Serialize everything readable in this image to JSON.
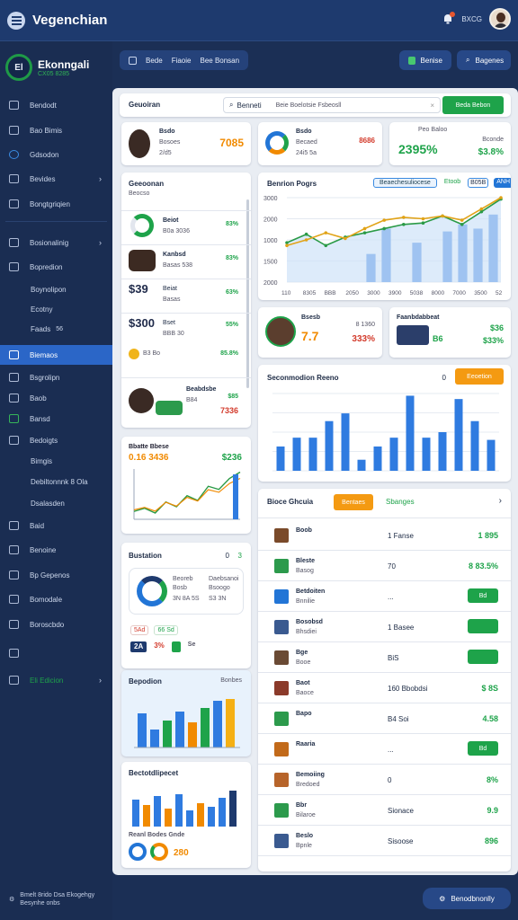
{
  "app": {
    "title": "Vegenchian",
    "code": "BXCG"
  },
  "brand": {
    "name": "Ekonngali",
    "sub": "CX05 8285"
  },
  "sidebar": {
    "items": [
      {
        "label": "Bendodt"
      },
      {
        "label": "Bao Bimis"
      },
      {
        "label": "Gdsodon"
      },
      {
        "label": "Bevides"
      },
      {
        "label": "Bongtgriqien"
      },
      {
        "label": "Bosionalinig"
      },
      {
        "label": "Bopredion"
      },
      {
        "label": "Boynolipon"
      },
      {
        "label": "Ecotny"
      },
      {
        "label": "Faads",
        "badge": "56"
      },
      {
        "label": "Biemaos"
      },
      {
        "label": "Bsgrolipn"
      },
      {
        "label": "Baob"
      },
      {
        "label": "Bansd"
      },
      {
        "label": "Bedoigts"
      },
      {
        "label": "Bimgis"
      },
      {
        "label": "Debiltonnnk 8 Ola"
      },
      {
        "label": "Dsalasden"
      },
      {
        "label": "Baid"
      },
      {
        "label": "Benoine"
      },
      {
        "label": "Bp Gepenos"
      },
      {
        "label": "Bomodale"
      },
      {
        "label": "Boroscbdo"
      },
      {
        "label": "Eli Edicion"
      }
    ],
    "footer": "Bmelt 8rido Dsa Ekogehgy Besynhe onbs"
  },
  "subheader": {
    "crumbs": [
      "Bede",
      "Fiaoie",
      "Bee Bonsan"
    ],
    "btn1": "Benise",
    "btn2": "Bagenes"
  },
  "panel": {
    "title": "Geuoiran",
    "search": "Benneti",
    "search_placeholder": "Beie Boelotsie Fsbeosll",
    "button": "Beda Bebon"
  },
  "stats": {
    "s1": {
      "label": "Bsdo",
      "line2": "Bosoes",
      "line3": "2/d5",
      "value": "7085"
    },
    "s2": {
      "label": "Bsdo",
      "line2": "Becaed",
      "line3": "24i5 5a",
      "value": "8686"
    },
    "s3": {
      "label": "Peo Baloo",
      "big": "2395%",
      "line2": "Bconde",
      "value": "$3.8%"
    }
  },
  "leftlist": {
    "title": "Geeoonan",
    "sub": "Beocso",
    "items": [
      {
        "name": "Beiot",
        "line2": "B0a 3036",
        "value": "83%"
      },
      {
        "name": "Kanbsd",
        "line2": "Basas 538",
        "value": "83%"
      },
      {
        "name": "Beiat",
        "big": "$39",
        "line2": "Basas",
        "value": "63%"
      },
      {
        "name": "Bset",
        "big": "$300",
        "line2": "BBB 30",
        "value": "55%",
        "sub": "B3 Bo",
        "val2": "85.8%"
      },
      {
        "name": "Beabdsbe",
        "line2": "B84",
        "value": "$85",
        "val2": "7336"
      }
    ]
  },
  "trend": {
    "title": "Bbatte Bbese",
    "big": "0.16 3436",
    "value": "$236"
  },
  "donutcard": {
    "title": "Bustation",
    "val": "0",
    "icon": "3",
    "l1": "Beoreb",
    "l2": "Bosb",
    "l3": "3N 8A 5S",
    "r1": "Daebsanoi",
    "r2": "Bsoogo",
    "r3": "S3 3N"
  },
  "tagrow": {
    "a": "5Ad",
    "b": "66 Sd",
    "c": "2A",
    "d": "3%",
    "e": "Se"
  },
  "minibar": {
    "title": "Bepodion",
    "legend": "Bonbes"
  },
  "minibar2": {
    "title": "Bectotdlipecet",
    "foot": "Reanl Bodes Gnde",
    "foot_val": "280"
  },
  "mainchart": {
    "title": "Benrion Pogrs",
    "tab1": "Beaechesuliocese",
    "tab2": "Etoob",
    "tab3": "B05B",
    "tab4": "ANH"
  },
  "chart_data": [
    {
      "type": "line",
      "title": "Benrion Pogrs",
      "categories": [
        "110",
        "8305",
        "BBB",
        "2050",
        "3000",
        "3900",
        "5038",
        "8000",
        "7000",
        "3500",
        "52"
      ],
      "ylim": [
        0,
        3000
      ],
      "yticks": [
        "2000",
        "1500",
        "1000",
        "2000",
        "3000"
      ],
      "xlabel": "",
      "ylabel": "",
      "series": [
        {
          "values": [
            1400,
            1700,
            1300,
            1600,
            1750,
            1900,
            2050,
            2100,
            2350,
            2050,
            2500,
            2950
          ]
        },
        {
          "values": [
            1300,
            1500,
            1750,
            1550,
            1900,
            2200,
            2300,
            2250,
            2350,
            2200,
            2600,
            3000
          ]
        }
      ],
      "bars": [
        0,
        0,
        0,
        0,
        0,
        1000,
        1900,
        0,
        1400,
        0,
        1800,
        2050,
        1900,
        2400
      ],
      "grid": true
    },
    {
      "type": "bar",
      "title": "Seconmodion Reeno",
      "values": [
        22,
        30,
        30,
        45,
        52,
        10,
        22,
        30,
        68,
        30,
        35,
        65,
        45,
        28
      ],
      "ylim": [
        0,
        70
      ],
      "grid": true
    }
  ],
  "promo": {
    "title": "Bsesb",
    "big": "7.7",
    "line2": "8 1360",
    "value": "333%",
    "v2": "$3.8%"
  },
  "promo2": {
    "title": "Faanbdabbeat",
    "value": "$36",
    "line2": "B6",
    "v2": "$33%"
  },
  "bar2": {
    "title": "Seconmodion Reeno",
    "val": "0",
    "btn": "Eeoetion"
  },
  "table": {
    "title": "Bioce Ghcuia",
    "tab_active": "Bentaes",
    "tab2": "Sbanges",
    "rows": [
      {
        "name": "Boob",
        "col": "1 Fanse",
        "value": "1 895"
      },
      {
        "name": "Bleste",
        "name2": "Basog",
        "col": "70",
        "value": "8 83.5%"
      },
      {
        "name": "Betdoiten",
        "name2": "Bnnilie",
        "col": "...",
        "btn": "Bd"
      },
      {
        "name": "Bosobsd",
        "name2": "Bhsdiei",
        "col": "1 Basee",
        "btn": ""
      },
      {
        "name": "Bge",
        "name2": "Booe",
        "col": "BiS",
        "btn": ""
      },
      {
        "name": "Baot",
        "name2": "Baoce",
        "col": "160 Bbobdsi",
        "value": "$ 8S"
      },
      {
        "name": "Bapo",
        "col": "B4 Soi",
        "value": "4.58"
      },
      {
        "name": "Raaria",
        "col": "...",
        "btn": "Bd"
      },
      {
        "name": "Bemoiing",
        "name2": "Bredoed",
        "col": "0",
        "value": "8%"
      },
      {
        "name": "Bbr",
        "name2": "Bilaroe",
        "col": "Sionace",
        "value": "9.9"
      },
      {
        "name": "Beslo",
        "name2": "Bpnle",
        "col": "Sisoose",
        "value": "896"
      }
    ]
  },
  "bottom_btn": "Benodbnonlly"
}
